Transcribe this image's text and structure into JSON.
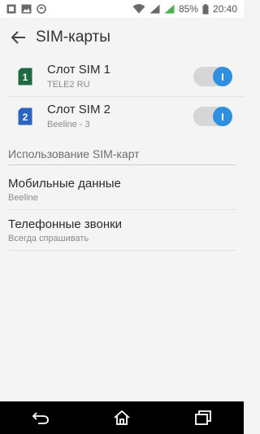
{
  "status_bar": {
    "battery_percent": "85%",
    "time": "20:40",
    "left_icons": [
      "sim-card-notification-icon",
      "image-notification-icon",
      "sync-icon"
    ],
    "right_icons": [
      "wifi-icon",
      "signal-icon",
      "battery-charging-icon"
    ]
  },
  "app_bar": {
    "title": "SIM-карты",
    "back_icon": "arrow-back-icon"
  },
  "sims": [
    {
      "slot_number": "1",
      "name": "Слот SIM 1",
      "carrier": "TELE2 RU",
      "enabled": true,
      "color": "#1e6b43"
    },
    {
      "slot_number": "2",
      "name": "Слот SIM 2",
      "carrier": "Beeline - 3",
      "enabled": true,
      "color": "#2a64c0"
    }
  ],
  "usage_section": {
    "header": "Использование SIM-карт",
    "items": [
      {
        "title": "Мобильные данные",
        "subtitle": "Beeline"
      },
      {
        "title": "Телефонные звонки",
        "subtitle": "Всегда спрашивать"
      }
    ]
  },
  "nav_bar": {
    "icons": [
      "back-nav-icon",
      "home-nav-icon",
      "recents-nav-icon"
    ]
  },
  "colors": {
    "accent": "#2f8fe0",
    "toggle_track": "#d6d6d6",
    "background": "#f4f4f4"
  }
}
